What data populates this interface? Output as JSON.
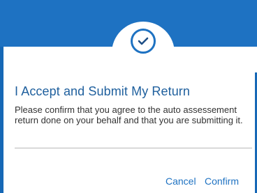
{
  "dialog": {
    "icon": "check-icon",
    "title": "I Accept and Submit My Return",
    "message": "Please confirm that you agree to the auto assessement return done on your behalf and that you are submitting it.",
    "buttons": {
      "cancel_label": "Cancel",
      "confirm_label": "Confirm"
    }
  },
  "colors": {
    "header": "#1e72c2",
    "accent": "#1e72c2",
    "title": "#1e5f9d",
    "text": "#333333",
    "divider": "#b8b8b8"
  }
}
